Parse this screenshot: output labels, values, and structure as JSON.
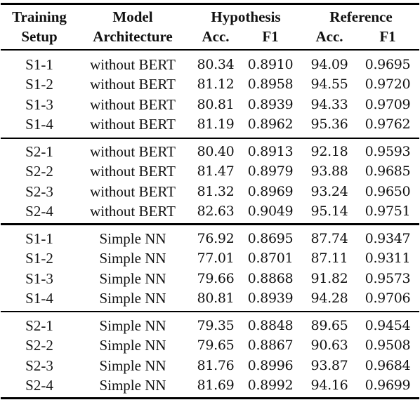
{
  "table": {
    "headers": {
      "training_setup": [
        "Training",
        "Setup"
      ],
      "model_architecture": [
        "Model",
        "Architecture"
      ],
      "hypothesis": "Hypothesis",
      "reference": "Reference",
      "acc": "Acc.",
      "f1": "F1"
    },
    "groups": [
      {
        "rows": [
          {
            "setup": "S1-1",
            "model": "without BERT",
            "hyp_acc": "80.34",
            "hyp_f1": "0.8910",
            "ref_acc": "94.09",
            "ref_f1": "0.9695"
          },
          {
            "setup": "S1-2",
            "model": "without BERT",
            "hyp_acc": "81.12",
            "hyp_f1": "0.8958",
            "ref_acc": "94.55",
            "ref_f1": "0.9720"
          },
          {
            "setup": "S1-3",
            "model": "without BERT",
            "hyp_acc": "80.81",
            "hyp_f1": "0.8939",
            "ref_acc": "94.33",
            "ref_f1": "0.9709"
          },
          {
            "setup": "S1-4",
            "model": "without BERT",
            "hyp_acc": "81.19",
            "hyp_f1": "0.8962",
            "ref_acc": "95.36",
            "ref_f1": "0.9762"
          }
        ]
      },
      {
        "rows": [
          {
            "setup": "S2-1",
            "model": "without BERT",
            "hyp_acc": "80.40",
            "hyp_f1": "0.8913",
            "ref_acc": "92.18",
            "ref_f1": "0.9593"
          },
          {
            "setup": "S2-2",
            "model": "without BERT",
            "hyp_acc": "81.47",
            "hyp_f1": "0.8979",
            "ref_acc": "93.88",
            "ref_f1": "0.9685"
          },
          {
            "setup": "S2-3",
            "model": "without BERT",
            "hyp_acc": "81.32",
            "hyp_f1": "0.8969",
            "ref_acc": "93.24",
            "ref_f1": "0.9650"
          },
          {
            "setup": "S2-4",
            "model": "without BERT",
            "hyp_acc": "82.63",
            "hyp_f1": "0.9049",
            "ref_acc": "95.14",
            "ref_f1": "0.9751"
          }
        ]
      },
      {
        "rows": [
          {
            "setup": "S1-1",
            "model": "Simple NN",
            "hyp_acc": "76.92",
            "hyp_f1": "0.8695",
            "ref_acc": "87.74",
            "ref_f1": "0.9347"
          },
          {
            "setup": "S1-2",
            "model": "Simple NN",
            "hyp_acc": "77.01",
            "hyp_f1": "0.8701",
            "ref_acc": "87.11",
            "ref_f1": "0.9311"
          },
          {
            "setup": "S1-3",
            "model": "Simple NN",
            "hyp_acc": "79.66",
            "hyp_f1": "0.8868",
            "ref_acc": "91.82",
            "ref_f1": "0.9573"
          },
          {
            "setup": "S1-4",
            "model": "Simple NN",
            "hyp_acc": "80.81",
            "hyp_f1": "0.8939",
            "ref_acc": "94.28",
            "ref_f1": "0.9706"
          }
        ]
      },
      {
        "rows": [
          {
            "setup": "S2-1",
            "model": "Simple NN",
            "hyp_acc": "79.35",
            "hyp_f1": "0.8848",
            "ref_acc": "89.65",
            "ref_f1": "0.9454"
          },
          {
            "setup": "S2-2",
            "model": "Simple NN",
            "hyp_acc": "79.65",
            "hyp_f1": "0.8867",
            "ref_acc": "90.63",
            "ref_f1": "0.9508"
          },
          {
            "setup": "S2-3",
            "model": "Simple NN",
            "hyp_acc": "81.76",
            "hyp_f1": "0.8996",
            "ref_acc": "93.87",
            "ref_f1": "0.9684"
          },
          {
            "setup": "S2-4",
            "model": "Simple NN",
            "hyp_acc": "81.69",
            "hyp_f1": "0.8992",
            "ref_acc": "94.16",
            "ref_f1": "0.9699"
          }
        ]
      }
    ]
  }
}
